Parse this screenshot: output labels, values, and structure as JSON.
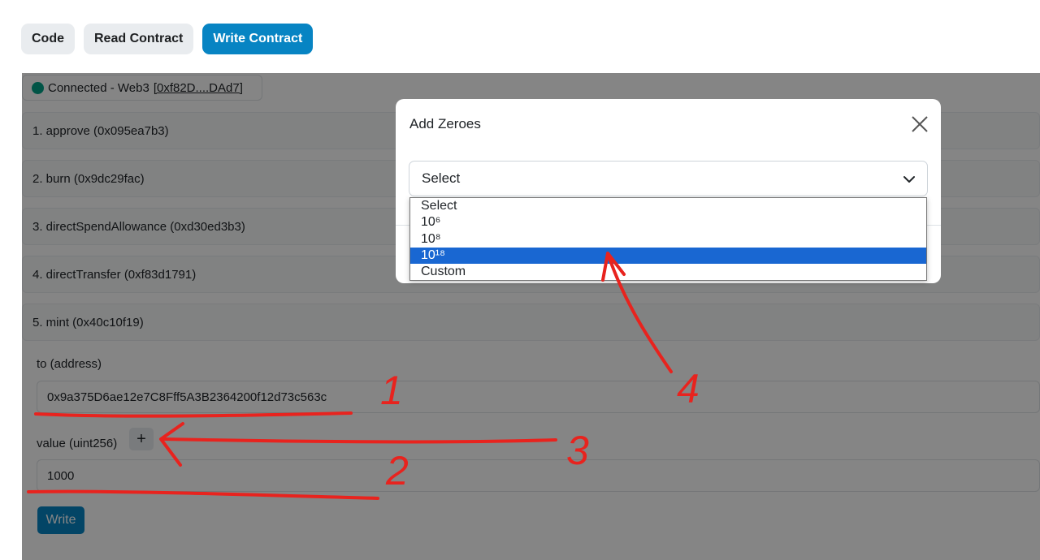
{
  "tabs": {
    "code": "Code",
    "read_contract": "Read Contract",
    "write_contract": "Write Contract"
  },
  "connection": {
    "status": "Connected - Web3",
    "address": "[0xf82D....DAd7]",
    "status_color": "#00a186"
  },
  "functions": [
    {
      "label": "1. approve (0x095ea7b3)"
    },
    {
      "label": "2. burn (0x9dc29fac)"
    },
    {
      "label": "3. directSpendAllowance (0xd30ed3b3)"
    },
    {
      "label": "4. directTransfer (0xf83d1791)"
    },
    {
      "label": "5. mint (0x40c10f19)"
    }
  ],
  "mint_form": {
    "to_label": "to (address)",
    "to_value": "0x9a375D6ae12e7C8Fff5A3B2364200f12d73c563c",
    "value_label": "value (uint256)",
    "add_zeroes_symbol": "+",
    "value_value": "1000",
    "write_label": "Write"
  },
  "modal": {
    "title": "Add Zeroes",
    "select_value": "Select",
    "options": [
      "Select",
      "10⁶",
      "10⁸",
      "10¹⁸",
      "Custom"
    ],
    "highlighted_option": "10¹⁸"
  },
  "annotations": {
    "markers": [
      "1",
      "2",
      "3",
      "4"
    ],
    "color": "#e8231e"
  },
  "colors": {
    "accent": "#0784c3",
    "highlight": "#1967d2"
  }
}
